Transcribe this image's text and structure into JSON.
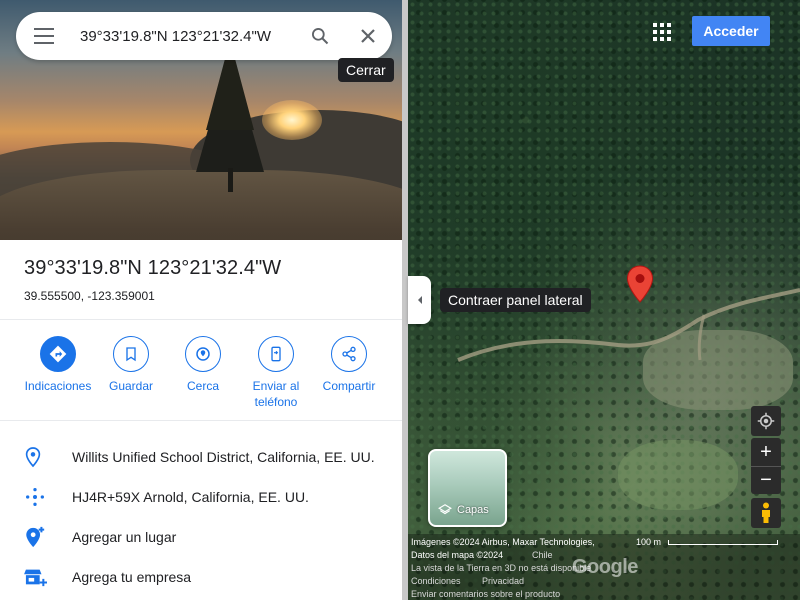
{
  "search": {
    "value": "39°33'19.8\"N 123°21'32.4\"W"
  },
  "tooltips": {
    "close": "Cerrar",
    "collapse": "Contraer panel lateral"
  },
  "place": {
    "title": "39°33'19.8\"N 123°21'32.4\"W",
    "decimal": "39.555500, -123.359001"
  },
  "actions": [
    {
      "label": "Indicaciones",
      "icon": "directions-icon"
    },
    {
      "label": "Guardar",
      "icon": "bookmark-icon"
    },
    {
      "label": "Cerca",
      "icon": "nearby-icon"
    },
    {
      "label_line1": "Enviar al",
      "label_line2": "teléfono",
      "icon": "send-to-phone-icon"
    },
    {
      "label": "Compartir",
      "icon": "share-icon"
    }
  ],
  "info": [
    {
      "text": "Willits Unified School District, California, EE. UU.",
      "icon": "location-pin-icon"
    },
    {
      "text": "HJ4R+59X Arnold, California, EE. UU.",
      "icon": "plus-code-icon"
    },
    {
      "text": "Agregar un lugar",
      "icon": "add-place-icon"
    },
    {
      "text": "Agrega tu empresa",
      "icon": "add-business-icon"
    }
  ],
  "map": {
    "signin": "Acceder",
    "layers": "Capas",
    "zoom_in": "+",
    "zoom_out": "−",
    "attribution": {
      "imagery": "Imágenes ©2024 Airbus, Maxar Technologies,",
      "map_data": "Datos del mapa ©2024",
      "country": "Chile",
      "scale": "100 m",
      "earth_3d": "La vista de la Tierra en 3D no está disponible",
      "terms": "Condiciones",
      "privacy": "Privacidad",
      "feedback": "Enviar comentarios sobre el producto",
      "logo": "Google"
    }
  },
  "colors": {
    "accent": "#1a73e8",
    "pin": "#ea4335",
    "signin": "#4285f4"
  }
}
